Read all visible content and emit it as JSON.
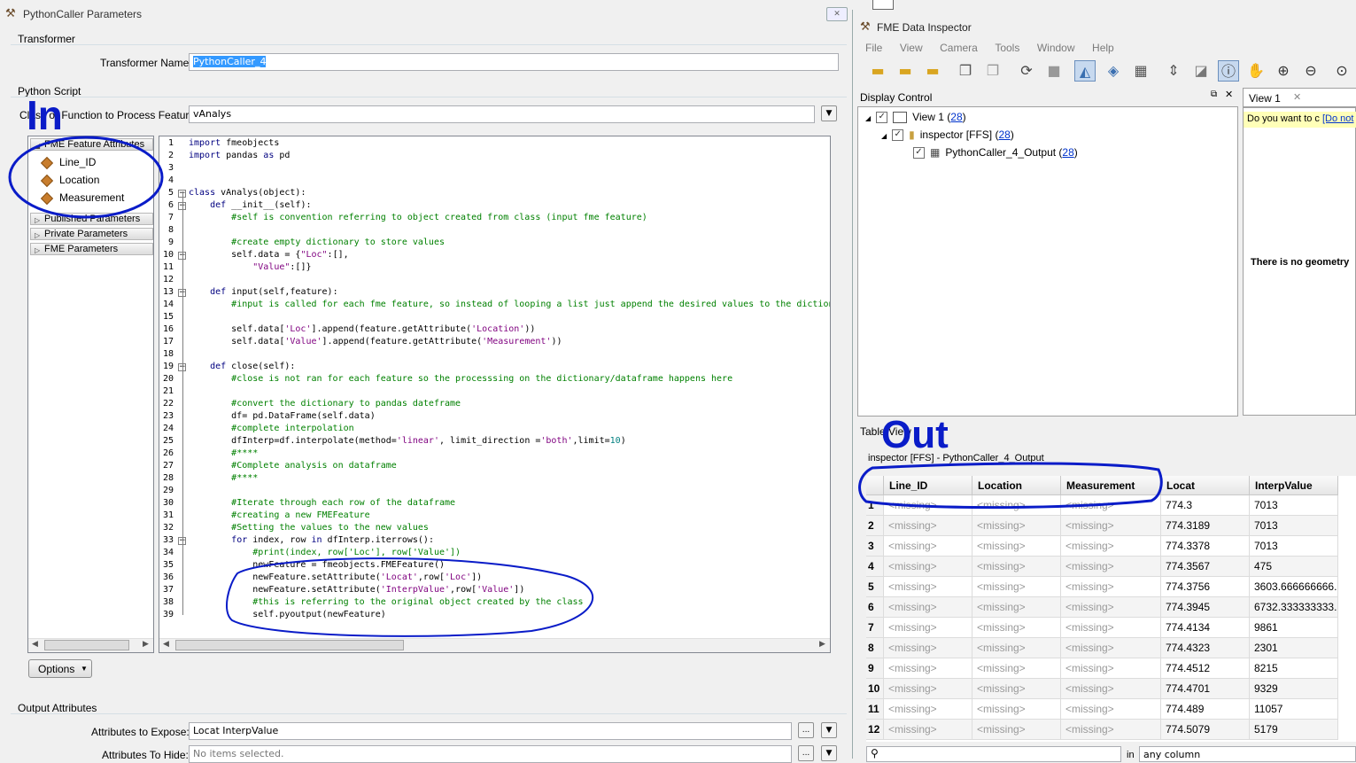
{
  "dialog": {
    "title": "PythonCaller Parameters",
    "transformer_group": "Transformer",
    "transformer_name_label": "Transformer Name:",
    "transformer_name_value": "PythonCaller_4",
    "python_script_group": "Python Script",
    "class_label": "Class or Function to Process Features:",
    "class_value": "vAnalys",
    "attribute_section": "FME Feature Attributes",
    "attributes": [
      "Line_ID",
      "Location",
      "Measurement"
    ],
    "sections": [
      "Published Parameters",
      "Private Parameters",
      "FME Parameters"
    ],
    "options_button": "Options",
    "output_group": "Output Attributes",
    "expose_label": "Attributes to Expose:",
    "expose_value": "Locat InterpValue",
    "hide_label": "Attributes To Hide:",
    "hide_value": "No items selected.",
    "ellipsis": "...",
    "close_glyph": "✕"
  },
  "code_lines": [
    "import fmeobjects",
    "import pandas as pd",
    "",
    "",
    "class vAnalys(object):",
    "    def __init__(self):",
    "        #self is convention referring to object created from class (input fme feature)",
    "",
    "        #create empty dictionary to store values",
    "        self.data = {\"Loc\":[],",
    "            \"Value\":[]}",
    "",
    "    def input(self,feature):",
    "        #input is called for each fme feature, so instead of looping a list just append the desired values to the diction",
    "",
    "        self.data['Loc'].append(feature.getAttribute('Location'))",
    "        self.data['Value'].append(feature.getAttribute('Measurement'))",
    "",
    "    def close(self):",
    "        #close is not ran for each feature so the processsing on the dictionary/dataframe happens here",
    "",
    "        #convert the dictionary to pandas dateframe",
    "        df= pd.DataFrame(self.data)",
    "        #complete interpolation",
    "        dfInterp=df.interpolate(method='linear', limit_direction ='both',limit=10)",
    "        #****",
    "        #Complete analysis on dataframe",
    "        #****",
    "",
    "        #Iterate through each row of the dataframe",
    "        #creating a new FMEFeature",
    "        #Setting the values to the new values",
    "        for index, row in dfInterp.iterrows():",
    "            #print(index, row['Loc'], row['Value'])",
    "            newFeature = fmeobjects.FMEFeature()",
    "            newFeature.setAttribute('Locat',row['Loc'])",
    "            newFeature.setAttribute('InterpValue',row['Value'])",
    "            #this is referring to the original object created by the class",
    "            self.pyoutput(newFeature)"
  ],
  "annotations": {
    "in_label": "In",
    "out_label": "Out"
  },
  "inspector": {
    "title": "FME Data Inspector",
    "menu": [
      "File",
      "View",
      "Camera",
      "Tools",
      "Window",
      "Help"
    ],
    "display_control_title": "Display Control",
    "tree": {
      "view": "View 1 (",
      "view_count": "28",
      "dataset": "inspector [FFS] (",
      "dataset_count": "28",
      "table": "PythonCaller_4_Output (",
      "table_count": "28",
      "close_paren": ")"
    },
    "view_tab": "View 1",
    "notice": "Do you want to c",
    "notice_link": "[Do not",
    "no_geometry": "There is no geometry",
    "table_view_title": "Table View",
    "table_source": "inspector [FFS] - PythonCaller_4_Output",
    "search_in": "in",
    "search_scope": "any column",
    "columns": [
      "Line_ID",
      "Location",
      "Measurement",
      "Locat",
      "InterpValue"
    ],
    "missing": "<missing>",
    "rows": [
      {
        "n": "1",
        "locat": "774.3",
        "value": "7013"
      },
      {
        "n": "2",
        "locat": "774.3189",
        "value": "7013"
      },
      {
        "n": "3",
        "locat": "774.3378",
        "value": "7013"
      },
      {
        "n": "4",
        "locat": "774.3567",
        "value": "475"
      },
      {
        "n": "5",
        "locat": "774.3756",
        "value": "3603.666666666..."
      },
      {
        "n": "6",
        "locat": "774.3945",
        "value": "6732.333333333..."
      },
      {
        "n": "7",
        "locat": "774.4134",
        "value": "9861"
      },
      {
        "n": "8",
        "locat": "774.4323",
        "value": "2301"
      },
      {
        "n": "9",
        "locat": "774.4512",
        "value": "8215"
      },
      {
        "n": "10",
        "locat": "774.4701",
        "value": "9329"
      },
      {
        "n": "11",
        "locat": "774.489",
        "value": "11057"
      },
      {
        "n": "12",
        "locat": "774.5079",
        "value": "5179"
      }
    ]
  }
}
